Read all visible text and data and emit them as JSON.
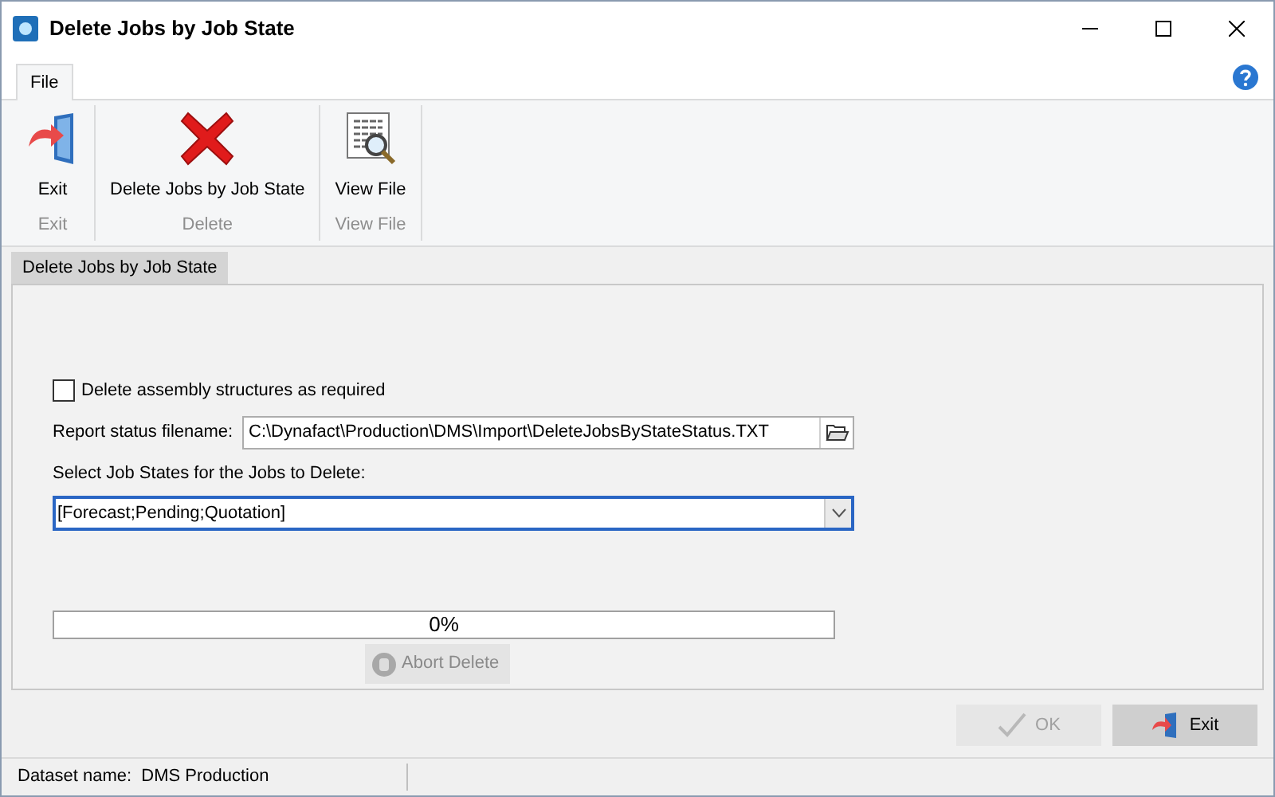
{
  "window": {
    "title": "Delete Jobs by Job State"
  },
  "menu_tabs": [
    {
      "label": "File",
      "selected": true
    }
  ],
  "ribbon_groups": [
    {
      "caption": "Exit",
      "buttons": [
        {
          "label": "Exit",
          "kind": "exit"
        }
      ]
    },
    {
      "caption": "Delete",
      "buttons": [
        {
          "label": "Delete Jobs by Job State",
          "kind": "delete"
        }
      ]
    },
    {
      "caption": "View File",
      "buttons": [
        {
          "label": "View File",
          "kind": "view"
        }
      ]
    }
  ],
  "page_tabs": [
    {
      "label": "Delete Jobs by Job State",
      "selected": true
    }
  ],
  "form": {
    "checkbox": {
      "label": "Delete assembly structures as required",
      "checked": false
    },
    "filename": {
      "label": "Report status filename:",
      "value": "C:\\Dynafact\\Production\\DMS\\Import\\DeleteJobsByStateStatus.TXT"
    },
    "states": {
      "label": "Select Job States for the Jobs to Delete:",
      "value": "[Forecast;Pending;Quotation]"
    },
    "progress": {
      "level": 0,
      "reading": "0%"
    },
    "abort": {
      "label": "Abort Delete",
      "disabled": true
    }
  },
  "buttons": [
    {
      "label": "OK",
      "kind": "ok",
      "disabled": true
    },
    {
      "label": "Exit",
      "kind": "exit",
      "disabled": false
    }
  ],
  "status_bar": {
    "dataset": "Dataset name:  DMS Production"
  }
}
